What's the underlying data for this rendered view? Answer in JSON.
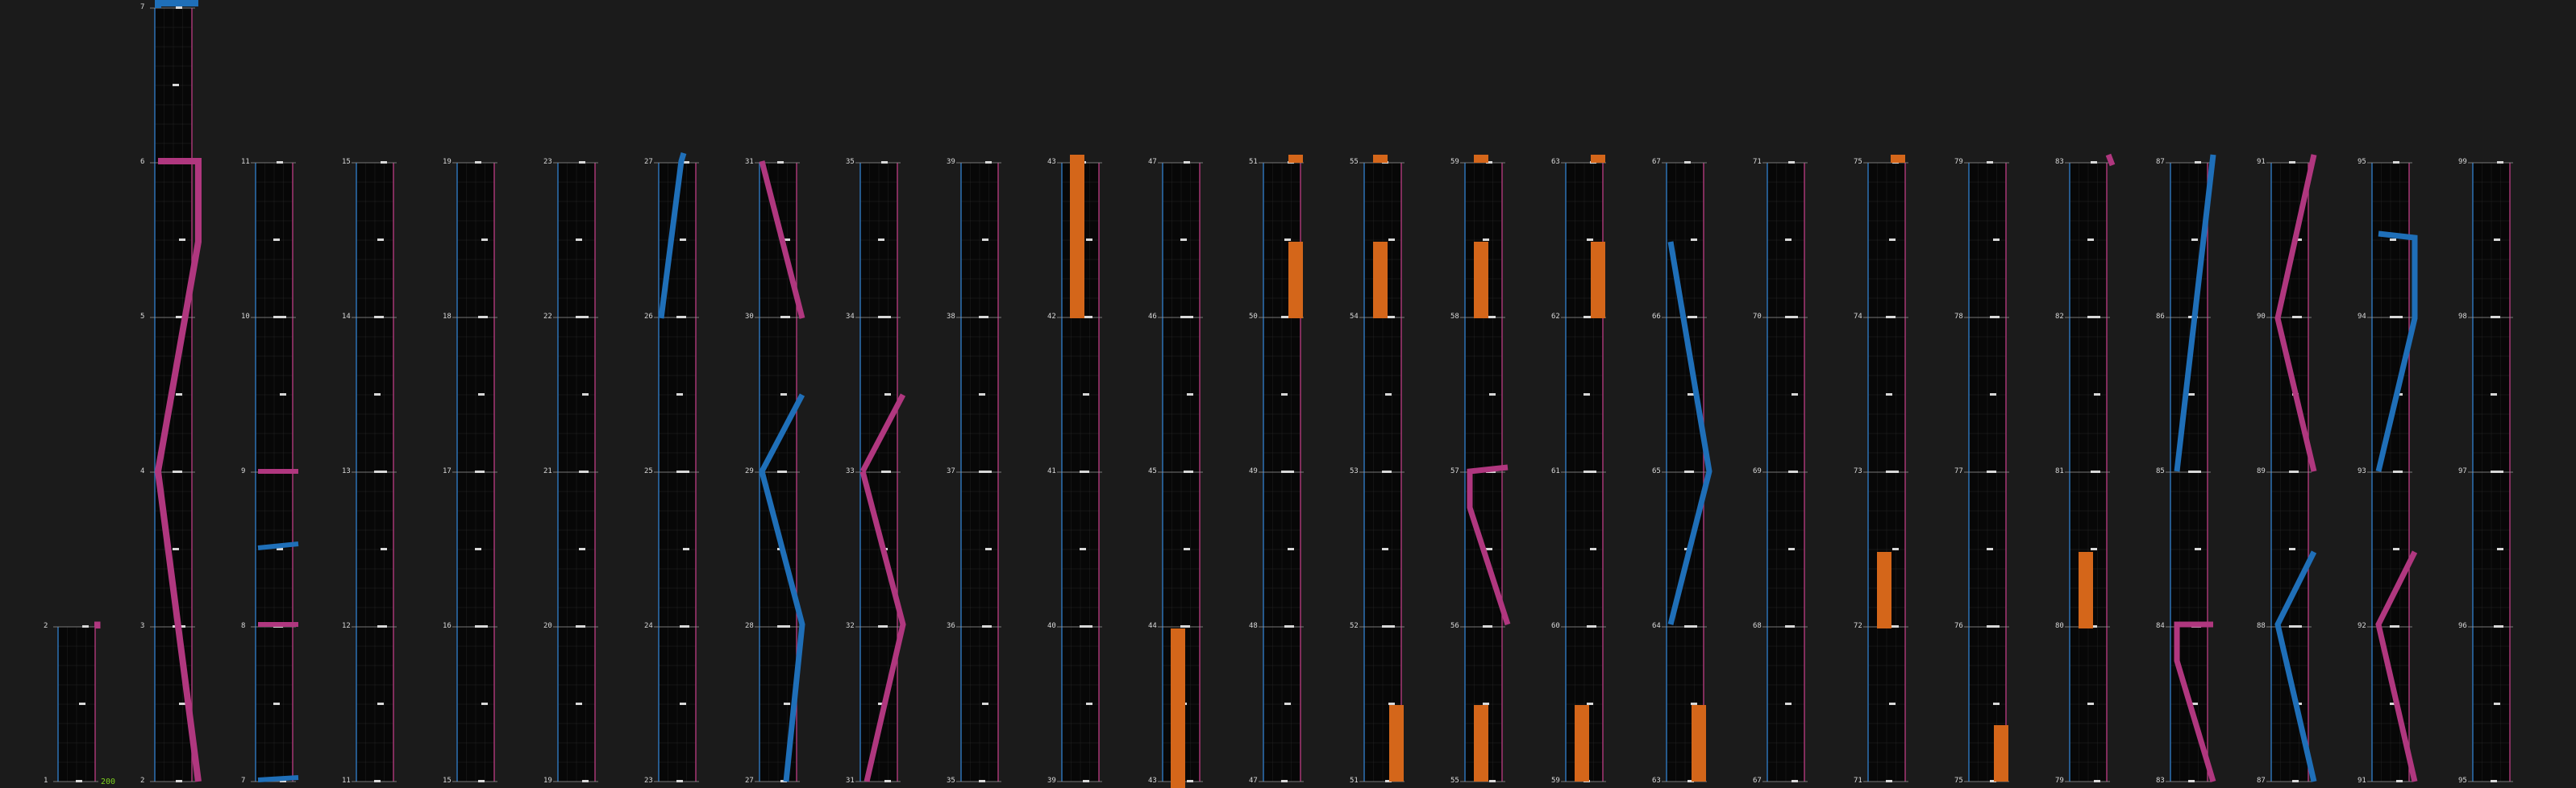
{
  "app": {
    "bottom_counter": "200"
  },
  "colors": {
    "background": "#1b1b1b",
    "lane_bg": "#070707",
    "lane_border_left": "#2f78c0",
    "lane_border_right": "#b03a7a",
    "blue_note": "#1f6fb8",
    "pink_note": "#b0377f",
    "orange_note": "#d4661a",
    "white_note": "#d8d8d8",
    "grid": "#3a3a3a",
    "bottom_counter": "#7ccf1d"
  },
  "columns": [
    {
      "col": 0,
      "lower": "1",
      "upper": "2",
      "rows": 1
    },
    {
      "col": 1,
      "lower": "2",
      "upper": "3",
      "mid": [
        "4",
        "5",
        "6"
      ],
      "top": "7",
      "rows": 5
    },
    {
      "col": 2,
      "lower": "7",
      "upper": "8",
      "mid": [
        "9",
        "10"
      ],
      "top": "11",
      "rows": 4
    },
    {
      "col": 3,
      "lower": "11",
      "upper": "12",
      "mid": [
        "13",
        "14"
      ],
      "top": "15",
      "rows": 4
    },
    {
      "col": 4,
      "lower": "15",
      "upper": "16",
      "mid": [
        "17",
        "18"
      ],
      "top": "19",
      "rows": 4
    },
    {
      "col": 5,
      "lower": "19",
      "upper": "20",
      "mid": [
        "21",
        "22"
      ],
      "top": "23",
      "rows": 4
    },
    {
      "col": 6,
      "lower": "23",
      "upper": "24",
      "mid": [
        "25",
        "26"
      ],
      "top": "27",
      "rows": 4
    },
    {
      "col": 7,
      "lower": "27",
      "upper": "28",
      "mid": [
        "29",
        "30"
      ],
      "top": "31",
      "rows": 4
    },
    {
      "col": 8,
      "lower": "31",
      "upper": "32",
      "mid": [
        "33",
        "34"
      ],
      "top": "35",
      "rows": 4
    },
    {
      "col": 9,
      "lower": "35",
      "upper": "36",
      "mid": [
        "37",
        "38"
      ],
      "top": "39",
      "rows": 4
    },
    {
      "col": 10,
      "lower": "39",
      "upper": "40",
      "mid": [
        "41",
        "42"
      ],
      "top": "43",
      "rows": 4
    },
    {
      "col": 11,
      "lower": "43",
      "upper": "44",
      "mid": [
        "45",
        "46"
      ],
      "top": "47",
      "rows": 4
    },
    {
      "col": 12,
      "lower": "47",
      "upper": "48",
      "mid": [
        "49",
        "50"
      ],
      "top": "51",
      "rows": 4
    },
    {
      "col": 13,
      "lower": "51",
      "upper": "52",
      "mid": [
        "53",
        "54"
      ],
      "top": "55",
      "rows": 4
    },
    {
      "col": 14,
      "lower": "55",
      "upper": "56",
      "mid": [
        "57",
        "58"
      ],
      "top": "59",
      "rows": 4
    },
    {
      "col": 15,
      "lower": "59",
      "upper": "60",
      "mid": [
        "61",
        "62"
      ],
      "top": "63",
      "rows": 4
    },
    {
      "col": 16,
      "lower": "63",
      "upper": "64",
      "mid": [
        "65",
        "66"
      ],
      "top": "67",
      "rows": 4
    },
    {
      "col": 17,
      "lower": "67",
      "upper": "68",
      "mid": [
        "69",
        "70"
      ],
      "top": "71",
      "rows": 4
    },
    {
      "col": 18,
      "lower": "71",
      "upper": "72",
      "mid": [
        "73",
        "74"
      ],
      "top": "75",
      "rows": 4
    },
    {
      "col": 19,
      "lower": "75",
      "upper": "76",
      "mid": [
        "77",
        "78"
      ],
      "top": "79",
      "rows": 4
    },
    {
      "col": 20,
      "lower": "79",
      "upper": "80",
      "mid": [
        "81",
        "82"
      ],
      "top": "83",
      "rows": 4
    },
    {
      "col": 21,
      "lower": "83",
      "upper": "84",
      "mid": [
        "85",
        "86"
      ],
      "top": "87",
      "rows": 4
    },
    {
      "col": 22,
      "lower": "87",
      "upper": "88",
      "mid": [
        "89",
        "90"
      ],
      "top": "91",
      "rows": 4
    },
    {
      "col": 23,
      "lower": "91",
      "upper": "92",
      "mid": [
        "93",
        "94"
      ],
      "top": "95",
      "rows": 4
    },
    {
      "col": 24,
      "lower": "95",
      "upper": "96",
      "mid": [
        "97",
        "98"
      ],
      "top": "99",
      "rows": 4
    }
  ]
}
